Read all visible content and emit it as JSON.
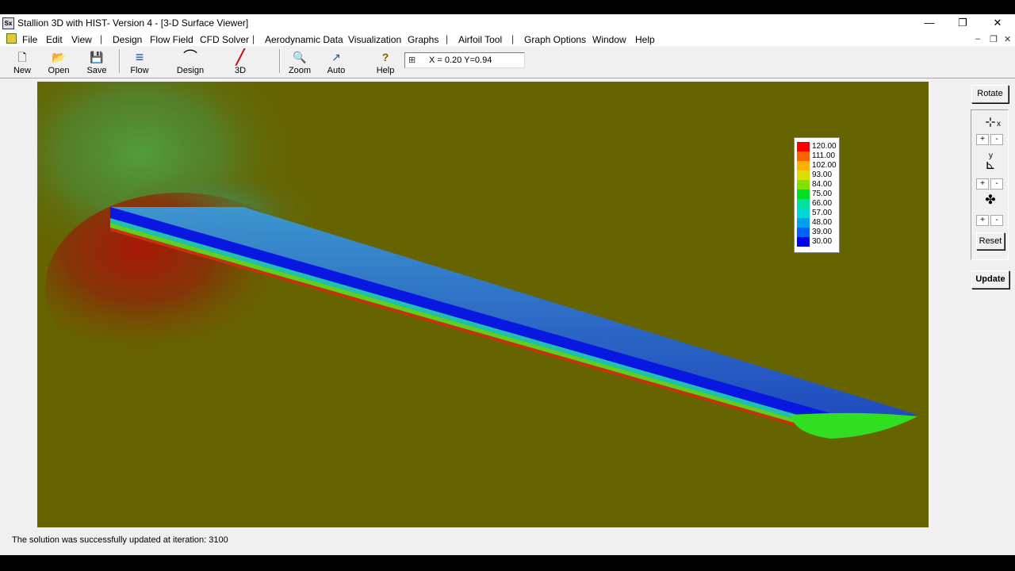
{
  "window": {
    "title": "Stallion 3D with HIST- Version 4 - [3-D Surface Viewer]",
    "app_icon_text": "Sx",
    "minimize_glyph": "—",
    "restore_glyph": "❐",
    "close_glyph": "✕"
  },
  "menubar": {
    "items": [
      "File",
      "Edit",
      "View",
      "Design",
      "Flow Field",
      "CFD Solver",
      "Aerodynamic Data",
      "Visualization",
      "Graphs",
      "Airfoil Tool",
      "Graph Options",
      "Window",
      "Help"
    ],
    "separator": "|",
    "mdi_min": "–",
    "mdi_restore": "❐",
    "mdi_close": "✕"
  },
  "toolbar": {
    "buttons": [
      {
        "label": "New",
        "icon": "new-icon",
        "glyph": "🗋"
      },
      {
        "label": "Open",
        "icon": "open-icon",
        "glyph": "📂"
      },
      {
        "label": "Save",
        "icon": "save-icon",
        "glyph": "💾"
      },
      {
        "label": "Flow",
        "icon": "flow-icon",
        "glyph": "≡"
      },
      {
        "label": "Design",
        "icon": "design-icon",
        "glyph": "⌒"
      },
      {
        "label": "3D",
        "icon": "3d-icon",
        "glyph": "╱"
      },
      {
        "label": "Zoom",
        "icon": "zoom-icon",
        "glyph": "🔍"
      },
      {
        "label": "Auto",
        "icon": "auto-icon",
        "glyph": "↗"
      },
      {
        "label": "Help",
        "icon": "help-icon",
        "glyph": "?"
      }
    ],
    "coord_icon": "⊞",
    "coord_text": "X = 0.20  Y=0.94"
  },
  "legend": {
    "values": [
      "120.00",
      "111.00",
      "102.00",
      "93.00",
      "84.00",
      "75.00",
      "66.00",
      "57.00",
      "48.00",
      "39.00",
      "30.00"
    ],
    "colors": [
      "#ff0000",
      "#ff6000",
      "#ffb000",
      "#d8e000",
      "#80e000",
      "#00e020",
      "#00e0a0",
      "#00d8d8",
      "#00a0f0",
      "#0060f0",
      "#0000f0"
    ]
  },
  "side_panel": {
    "rotate_label": "Rotate",
    "x_axis_label": "x",
    "y_axis_label": "y",
    "plus": "+",
    "minus": "-",
    "reset_label": "Reset",
    "update_label": "Update"
  },
  "colors": {
    "background": "#666400"
  },
  "status": {
    "text": "The solution was successfully updated at iteration: 3100"
  }
}
